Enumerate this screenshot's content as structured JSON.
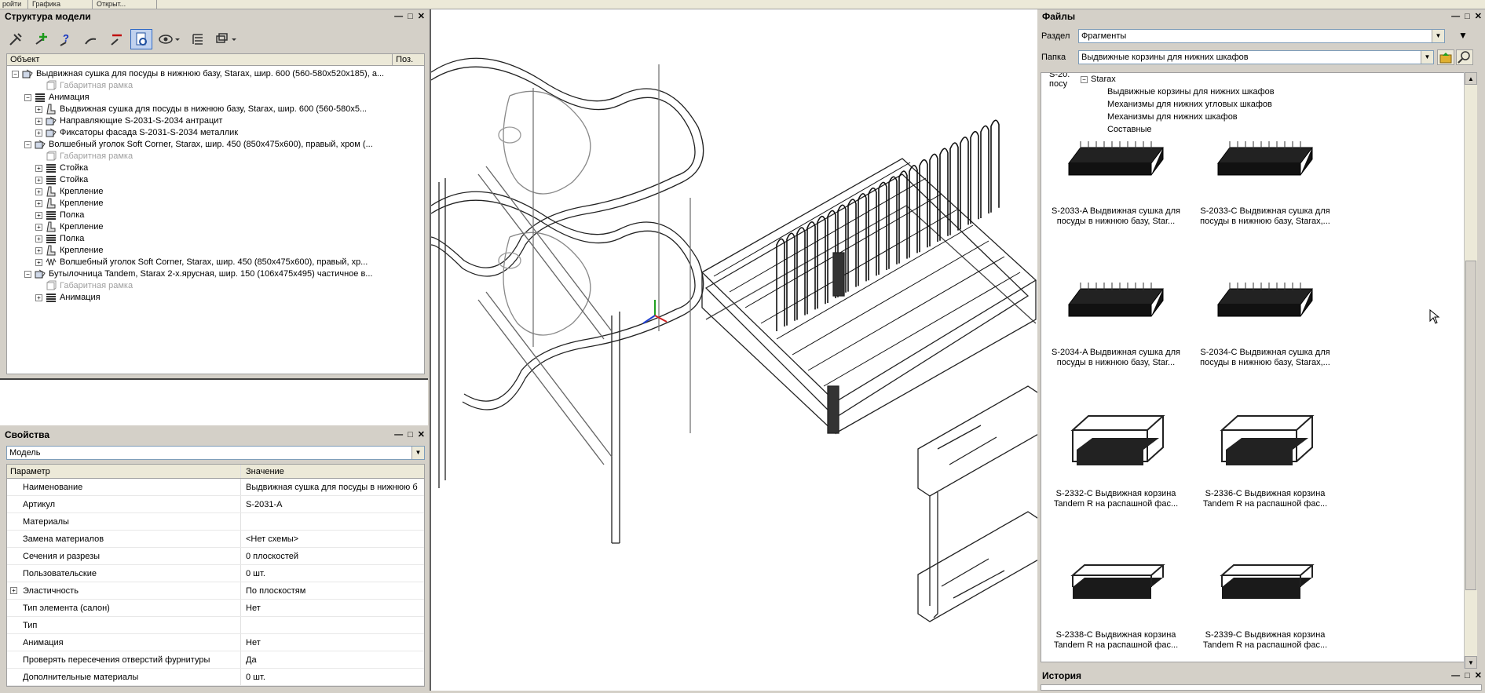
{
  "topstrip": {
    "tabs": [
      "ройти",
      "Графика",
      "Открыт..."
    ]
  },
  "structure": {
    "title": "Структура модели",
    "buttons": [
      "—",
      "□",
      "✕"
    ],
    "columns": {
      "object": "Объект",
      "pos": "Поз."
    },
    "rows": [
      {
        "text": "Выдвижная сушка для посуды в нижнюю базу, Starax, шир. 600 (560-580x520x185), а..."
      },
      {
        "text": "Габаритная рамка"
      },
      {
        "text": "Анимация"
      },
      {
        "text": "Выдвижная сушка для посуды в нижнюю базу, Starax, шир. 600 (560-580x5..."
      },
      {
        "text": "Направляющие S-2031-S-2034 антрацит"
      },
      {
        "text": "Фиксаторы фасада S-2031-S-2034 металлик"
      },
      {
        "text": "Волшебный уголок Soft Corner, Starax, шир. 450 (850x475x600), правый, хром (..."
      },
      {
        "text": "Габаритная рамка"
      },
      {
        "text": "Стойка"
      },
      {
        "text": "Стойка"
      },
      {
        "text": "Крепление"
      },
      {
        "text": "Крепление"
      },
      {
        "text": "Полка"
      },
      {
        "text": "Крепление"
      },
      {
        "text": "Полка"
      },
      {
        "text": "Крепление"
      },
      {
        "text": "Волшебный уголок Soft Corner, Starax, шир. 450 (850x475x600), правый, хр..."
      },
      {
        "text": "Бутылочница Tandem, Starax 2-х.ярусная, шир. 150 (106x475x495) частичное в..."
      },
      {
        "text": "Габаритная рамка"
      },
      {
        "text": "Анимация"
      }
    ]
  },
  "properties": {
    "title": "Свойства",
    "selector": "Модель",
    "columns": {
      "param": "Параметр",
      "value": "Значение"
    },
    "rows": [
      {
        "key": "Наименование",
        "value": "Выдвижная сушка для посуды в нижнюю б"
      },
      {
        "key": "Артикул",
        "value": "S-2031-A"
      },
      {
        "key": "Материалы",
        "value": ""
      },
      {
        "key": "Замена материалов",
        "value": "<Нет схемы>"
      },
      {
        "key": "Сечения и разрезы",
        "value": "0 плоскостей"
      },
      {
        "key": "Пользовательские",
        "value": "0 шт."
      },
      {
        "key": "Эластичность",
        "value": "По плоскостям"
      },
      {
        "key": "Тип элемента (салон)",
        "value": "Нет"
      },
      {
        "key": "Тип",
        "value": ""
      },
      {
        "key": "Анимация",
        "value": "Нет"
      },
      {
        "key": "Проверять пересечения отверстий фурнитуры",
        "value": "Да"
      },
      {
        "key": "Дополнительные материалы",
        "value": "0 шт."
      }
    ]
  },
  "files": {
    "title": "Файлы",
    "section_label": "Раздел",
    "section_value": "Фрагменты",
    "folder_label": "Папка",
    "folder_value": "Выдвижные корзины для нижних шкафов",
    "partial_text": [
      "S-20.",
      "посу"
    ],
    "subtree": {
      "root": "Starax",
      "items": [
        "Выдвижные корзины для нижних шкафов",
        "Механизмы для нижних угловых шкафов",
        "Механизмы для нижних шкафов",
        "Составные"
      ]
    },
    "cards": [
      {
        "line1": "S-2033-A Выдвижная сушка для",
        "line2": "посуды в нижнюю базу, Star..."
      },
      {
        "line1": "S-2033-C Выдвижная сушка для",
        "line2": "посуды в нижнюю базу, Starax,..."
      },
      {
        "line1": "S-2034-A Выдвижная сушка для",
        "line2": "посуды в нижнюю базу, Star..."
      },
      {
        "line1": "S-2034-C Выдвижная сушка для",
        "line2": "посуды в нижнюю базу, Starax,..."
      },
      {
        "line1": "S-2332-C Выдвижная корзина",
        "line2": "Tandem R на распашной фас..."
      },
      {
        "line1": "S-2336-C Выдвижная корзина",
        "line2": "Tandem R на распашной фас..."
      },
      {
        "line1": "S-2338-C Выдвижная корзина",
        "line2": "Tandem R на распашной фас..."
      },
      {
        "line1": "S-2339-C Выдвижная корзина",
        "line2": "Tandem R на распашной фас..."
      }
    ]
  },
  "history": {
    "title": "История"
  }
}
